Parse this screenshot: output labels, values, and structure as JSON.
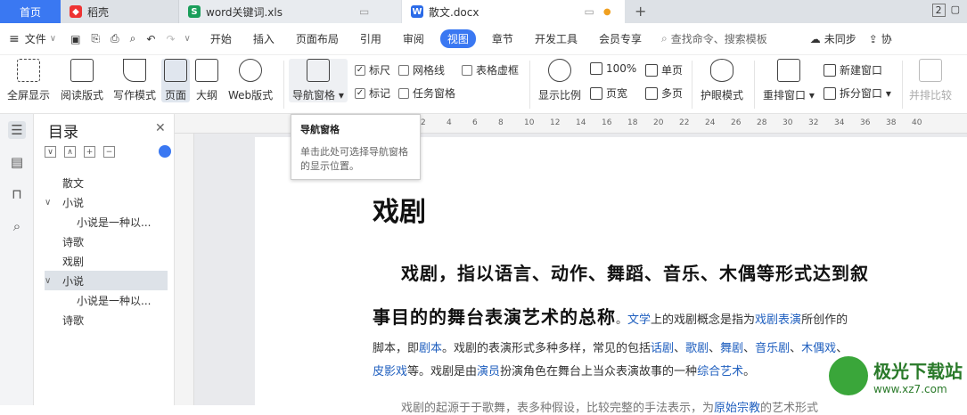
{
  "tabs": {
    "home": "首页",
    "daoke": "稻壳",
    "xls": "word关键词.xls",
    "docx": "散文.docx"
  },
  "menubar": {
    "file": "文件",
    "items": [
      "开始",
      "插入",
      "页面布局",
      "引用",
      "审阅",
      "视图",
      "章节",
      "开发工具",
      "会员专享"
    ],
    "search": "查找命令、搜索模板",
    "sync": "未同步",
    "share": "协"
  },
  "ribbon": {
    "fullscreen": "全屏显示",
    "reading": "阅读版式",
    "writing": "写作模式",
    "page": "页面",
    "outline": "大纲",
    "web": "Web版式",
    "navpane": "导航窗格",
    "ruler": "标尺",
    "markup": "标记",
    "gridline": "网格线",
    "taskpane": "任务窗格",
    "tablegrid": "表格虚框",
    "zoomratio": "显示比例",
    "z100": "100%",
    "pagewidth": "页宽",
    "single": "单页",
    "multi": "多页",
    "eyecare": "护眼模式",
    "arrange": "重排窗口",
    "newwin": "新建窗口",
    "splitwin": "拆分窗口",
    "compare": "并排比较"
  },
  "tooltip": {
    "title": "导航窗格",
    "desc": "单击此处可选择导航窗格的显示位置。"
  },
  "nav": {
    "title": "目录",
    "items": [
      {
        "label": "散文",
        "indent": 0,
        "expand": ""
      },
      {
        "label": "小说",
        "indent": 0,
        "expand": "∨"
      },
      {
        "label": "小说是一种以...",
        "indent": 1,
        "expand": ""
      },
      {
        "label": "诗歌",
        "indent": 0,
        "expand": ""
      },
      {
        "label": "戏剧",
        "indent": 0,
        "expand": ""
      },
      {
        "label": "小说",
        "indent": 0,
        "expand": "∨",
        "selected": true
      },
      {
        "label": "小说是一种以...",
        "indent": 1,
        "expand": ""
      },
      {
        "label": "诗歌",
        "indent": 0,
        "expand": ""
      }
    ]
  },
  "ruler": [
    "2",
    "4",
    "6",
    "8",
    "10",
    "12",
    "14",
    "16",
    "18",
    "20",
    "22",
    "24",
    "26",
    "28",
    "30",
    "32",
    "34",
    "36",
    "38",
    "40"
  ],
  "doc": {
    "title": "戏剧",
    "bold1": "戏剧，指以语言、动作、舞蹈、音乐、木偶等形式达到叙",
    "bold2": "事目的的舞台表演艺术的总称",
    "l2a": "。",
    "l2link1": "文学",
    "l2b": "上的戏剧概念是指为",
    "l2link2": "戏剧表演",
    "l2c": "所创作的",
    "l3a": "脚本，即",
    "l3link1": "剧本",
    "l3b": "。戏剧的表演形式多种多样，常见的包括",
    "l3link2": "话剧",
    "l3s1": "、",
    "l3link3": "歌剧",
    "l3s2": "、",
    "l3link4": "舞剧",
    "l3s3": "、",
    "l3link5": "音乐剧",
    "l3s4": "、",
    "l3link6": "木偶戏",
    "l3s5": "、",
    "l4link1": "皮影戏",
    "l4a": "等。戏剧是由",
    "l4link2": "演员",
    "l4b": "扮演角色在舞台上当众表演故事的一种",
    "l4link3": "综合艺术",
    "l4c": "。",
    "l5": "戏剧的起源于于歌舞，表多种假设，比较完整的手法表示，为",
    "l5link": "原始宗教",
    "l5b": "的艺术形式"
  },
  "watermark": {
    "name": "极光下载站",
    "url": "www.xz7.com"
  },
  "colors": {
    "accent": "#3a78f2",
    "link": "#1f5fbf"
  }
}
